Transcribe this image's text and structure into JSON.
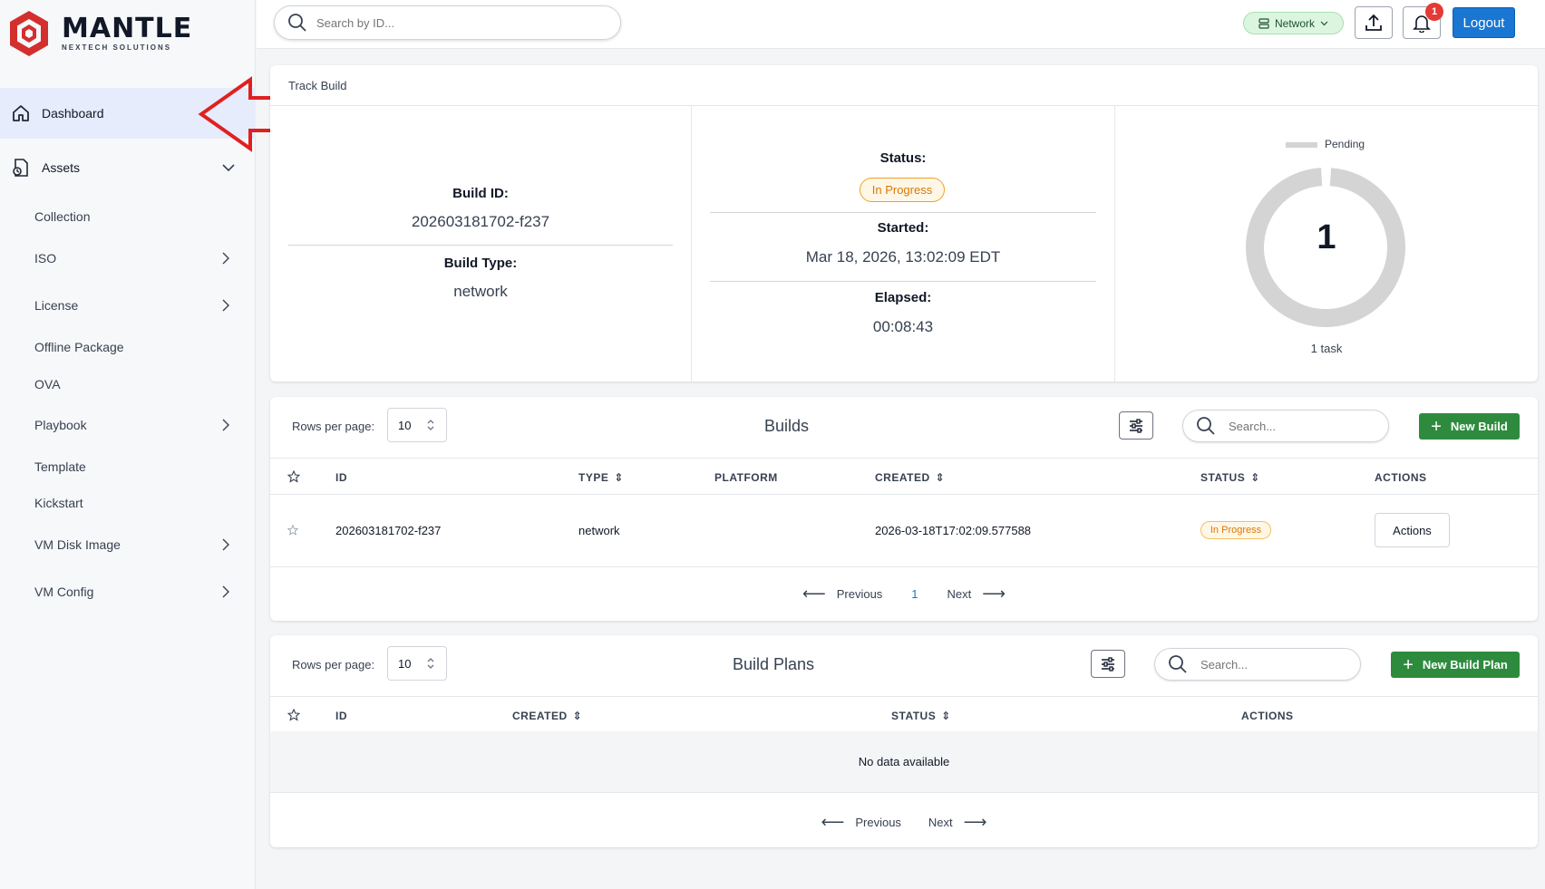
{
  "brand": {
    "name": "MANTLE",
    "tagline": "NEXTECH SOLUTIONS",
    "accent": "#d32f2f"
  },
  "sidebar": {
    "items": [
      {
        "label": "Dashboard",
        "icon": "home-icon"
      },
      {
        "label": "Assets",
        "icon": "assets-icon"
      }
    ],
    "sub_items": [
      {
        "label": "Collection"
      },
      {
        "label": "ISO"
      },
      {
        "label": "License"
      },
      {
        "label": "Offline Package"
      },
      {
        "label": "OVA"
      },
      {
        "label": "Playbook"
      },
      {
        "label": "Template"
      },
      {
        "label": "Kickstart"
      },
      {
        "label": "VM Disk Image"
      },
      {
        "label": "VM Config"
      }
    ]
  },
  "topbar": {
    "search_placeholder": "Search by ID...",
    "network_label": "Network",
    "notification_count": "1",
    "logout_label": "Logout"
  },
  "track_build": {
    "title": "Track Build",
    "build_id_label": "Build ID:",
    "build_id": "202603181702-f237",
    "build_type_label": "Build Type:",
    "build_type": "network",
    "status_label": "Status:",
    "status": "In Progress",
    "started_label": "Started:",
    "started": "Mar 18, 2026, 13:02:09 EDT",
    "elapsed_label": "Elapsed:",
    "elapsed": "00:08:43",
    "legend_label": "Pending",
    "task_count": "1",
    "task_caption": "1 task"
  },
  "builds": {
    "rows_label": "Rows per page:",
    "rows_value": "10",
    "title": "Builds",
    "search_placeholder": "Search...",
    "new_label": "New Build",
    "columns": [
      "ID",
      "TYPE",
      "PLATFORM",
      "CREATED",
      "STATUS",
      "ACTIONS"
    ],
    "rows": [
      {
        "id": "202603181702-f237",
        "type": "network",
        "platform": "",
        "created": "2026-03-18T17:02:09.577588",
        "status": "In Progress",
        "action": "Actions"
      }
    ],
    "pager": {
      "prev": "Previous",
      "page": "1",
      "next": "Next"
    }
  },
  "build_plans": {
    "rows_label": "Rows per page:",
    "rows_value": "10",
    "title": "Build Plans",
    "search_placeholder": "Search...",
    "new_label": "New Build Plan",
    "columns": [
      "ID",
      "CREATED",
      "STATUS",
      "ACTIONS"
    ],
    "empty": "No data available",
    "pager": {
      "prev": "Previous",
      "next": "Next"
    }
  }
}
